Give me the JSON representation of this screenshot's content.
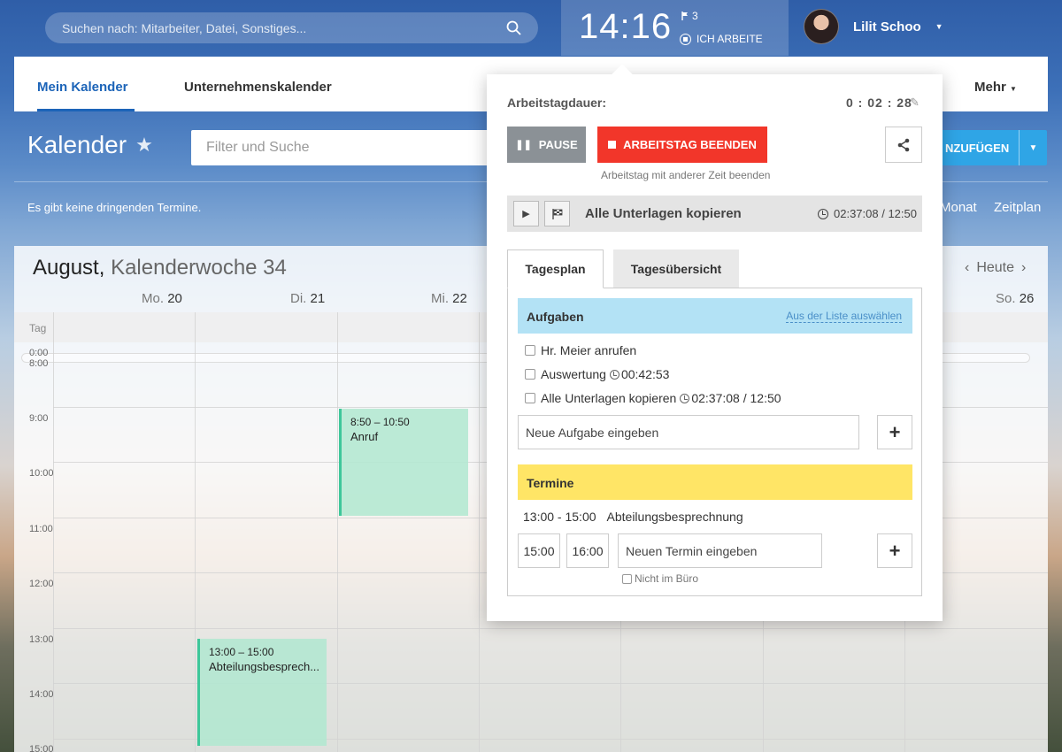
{
  "topbar": {
    "search_placeholder": "Suchen nach: Mitarbeiter, Datei, Sonstiges...",
    "clock_time": "14:16",
    "flag_count": "3",
    "work_status": "ICH ARBEITE",
    "user_name": "Lilit Schoo"
  },
  "tabs": {
    "my_calendar": "Mein Kalender",
    "company_calendar": "Unternehmenskalender",
    "more": "Mehr"
  },
  "calendar": {
    "title": "Kalender",
    "filter_placeholder": "Filter und Suche",
    "add_label": "NZUFÜGEN",
    "notice": "Es gibt keine dringenden Termine.",
    "view_month": "Monat",
    "view_schedule": "Zeitplan",
    "week_month": "August,",
    "week_label": "Kalenderwoche 34",
    "today": "Heute",
    "allday_label": "Tag",
    "days": [
      {
        "name": "Mo.",
        "num": "20"
      },
      {
        "name": "Di.",
        "num": "21"
      },
      {
        "name": "Mi.",
        "num": "22"
      },
      {
        "name": "So.",
        "num": "26"
      }
    ],
    "hours": [
      "0:00",
      "8:00",
      "9:00",
      "10:00",
      "11:00",
      "12:00",
      "13:00",
      "14:00",
      "15:00"
    ],
    "events": [
      {
        "time": "8:50 – 10:50",
        "name": "Anruf"
      },
      {
        "time": "13:00 – 15:00",
        "name": "Abteilungsbesprech..."
      }
    ]
  },
  "popup": {
    "duration_label": "Arbeitstagdauer:",
    "duration_value": "0 : 02 : 28",
    "pause_label": "PAUSE",
    "end_label": "ARBEITSTAG BEENDEN",
    "end_other": "Arbeitstag mit anderer Zeit beenden",
    "current_task": "Alle Unterlagen kopieren",
    "current_task_time": "02:37:08 / 12:50",
    "tab_dayplan": "Tagesplan",
    "tab_overview": "Tagesübersicht",
    "tasks_heading": "Aufgaben",
    "tasks_link": "Aus der Liste auswählen",
    "tasks": [
      {
        "name": "Hr. Meier anrufen",
        "time": ""
      },
      {
        "name": "Auswertung",
        "time": "00:42:53"
      },
      {
        "name": "Alle Unterlagen kopieren",
        "time": "02:37:08 / 12:50"
      }
    ],
    "new_task_placeholder": "Neue Aufgabe eingeben",
    "appointments_heading": "Termine",
    "appointment_time": "13:00 - 15:00",
    "appointment_name": "Abteilungsbesprechnung",
    "start_time": "15:00",
    "end_time": "16:00",
    "new_appointment_placeholder": "Neuen Termin eingeben",
    "not_in_office": "Nicht im Büro"
  }
}
